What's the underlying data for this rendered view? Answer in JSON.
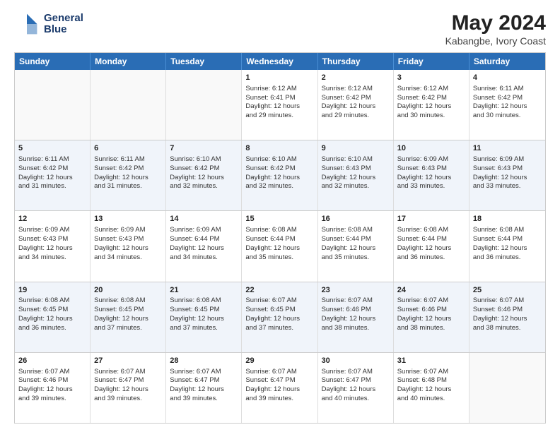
{
  "header": {
    "logo_line1": "General",
    "logo_line2": "Blue",
    "title": "May 2024",
    "subtitle": "Kabangbe, Ivory Coast"
  },
  "days": [
    "Sunday",
    "Monday",
    "Tuesday",
    "Wednesday",
    "Thursday",
    "Friday",
    "Saturday"
  ],
  "weeks": [
    [
      {
        "day": "",
        "text": ""
      },
      {
        "day": "",
        "text": ""
      },
      {
        "day": "",
        "text": ""
      },
      {
        "day": "1",
        "text": "Sunrise: 6:12 AM\nSunset: 6:41 PM\nDaylight: 12 hours\nand 29 minutes."
      },
      {
        "day": "2",
        "text": "Sunrise: 6:12 AM\nSunset: 6:42 PM\nDaylight: 12 hours\nand 29 minutes."
      },
      {
        "day": "3",
        "text": "Sunrise: 6:12 AM\nSunset: 6:42 PM\nDaylight: 12 hours\nand 30 minutes."
      },
      {
        "day": "4",
        "text": "Sunrise: 6:11 AM\nSunset: 6:42 PM\nDaylight: 12 hours\nand 30 minutes."
      }
    ],
    [
      {
        "day": "5",
        "text": "Sunrise: 6:11 AM\nSunset: 6:42 PM\nDaylight: 12 hours\nand 31 minutes."
      },
      {
        "day": "6",
        "text": "Sunrise: 6:11 AM\nSunset: 6:42 PM\nDaylight: 12 hours\nand 31 minutes."
      },
      {
        "day": "7",
        "text": "Sunrise: 6:10 AM\nSunset: 6:42 PM\nDaylight: 12 hours\nand 32 minutes."
      },
      {
        "day": "8",
        "text": "Sunrise: 6:10 AM\nSunset: 6:42 PM\nDaylight: 12 hours\nand 32 minutes."
      },
      {
        "day": "9",
        "text": "Sunrise: 6:10 AM\nSunset: 6:43 PM\nDaylight: 12 hours\nand 32 minutes."
      },
      {
        "day": "10",
        "text": "Sunrise: 6:09 AM\nSunset: 6:43 PM\nDaylight: 12 hours\nand 33 minutes."
      },
      {
        "day": "11",
        "text": "Sunrise: 6:09 AM\nSunset: 6:43 PM\nDaylight: 12 hours\nand 33 minutes."
      }
    ],
    [
      {
        "day": "12",
        "text": "Sunrise: 6:09 AM\nSunset: 6:43 PM\nDaylight: 12 hours\nand 34 minutes."
      },
      {
        "day": "13",
        "text": "Sunrise: 6:09 AM\nSunset: 6:43 PM\nDaylight: 12 hours\nand 34 minutes."
      },
      {
        "day": "14",
        "text": "Sunrise: 6:09 AM\nSunset: 6:44 PM\nDaylight: 12 hours\nand 34 minutes."
      },
      {
        "day": "15",
        "text": "Sunrise: 6:08 AM\nSunset: 6:44 PM\nDaylight: 12 hours\nand 35 minutes."
      },
      {
        "day": "16",
        "text": "Sunrise: 6:08 AM\nSunset: 6:44 PM\nDaylight: 12 hours\nand 35 minutes."
      },
      {
        "day": "17",
        "text": "Sunrise: 6:08 AM\nSunset: 6:44 PM\nDaylight: 12 hours\nand 36 minutes."
      },
      {
        "day": "18",
        "text": "Sunrise: 6:08 AM\nSunset: 6:44 PM\nDaylight: 12 hours\nand 36 minutes."
      }
    ],
    [
      {
        "day": "19",
        "text": "Sunrise: 6:08 AM\nSunset: 6:45 PM\nDaylight: 12 hours\nand 36 minutes."
      },
      {
        "day": "20",
        "text": "Sunrise: 6:08 AM\nSunset: 6:45 PM\nDaylight: 12 hours\nand 37 minutes."
      },
      {
        "day": "21",
        "text": "Sunrise: 6:08 AM\nSunset: 6:45 PM\nDaylight: 12 hours\nand 37 minutes."
      },
      {
        "day": "22",
        "text": "Sunrise: 6:07 AM\nSunset: 6:45 PM\nDaylight: 12 hours\nand 37 minutes."
      },
      {
        "day": "23",
        "text": "Sunrise: 6:07 AM\nSunset: 6:46 PM\nDaylight: 12 hours\nand 38 minutes."
      },
      {
        "day": "24",
        "text": "Sunrise: 6:07 AM\nSunset: 6:46 PM\nDaylight: 12 hours\nand 38 minutes."
      },
      {
        "day": "25",
        "text": "Sunrise: 6:07 AM\nSunset: 6:46 PM\nDaylight: 12 hours\nand 38 minutes."
      }
    ],
    [
      {
        "day": "26",
        "text": "Sunrise: 6:07 AM\nSunset: 6:46 PM\nDaylight: 12 hours\nand 39 minutes."
      },
      {
        "day": "27",
        "text": "Sunrise: 6:07 AM\nSunset: 6:47 PM\nDaylight: 12 hours\nand 39 minutes."
      },
      {
        "day": "28",
        "text": "Sunrise: 6:07 AM\nSunset: 6:47 PM\nDaylight: 12 hours\nand 39 minutes."
      },
      {
        "day": "29",
        "text": "Sunrise: 6:07 AM\nSunset: 6:47 PM\nDaylight: 12 hours\nand 39 minutes."
      },
      {
        "day": "30",
        "text": "Sunrise: 6:07 AM\nSunset: 6:47 PM\nDaylight: 12 hours\nand 40 minutes."
      },
      {
        "day": "31",
        "text": "Sunrise: 6:07 AM\nSunset: 6:48 PM\nDaylight: 12 hours\nand 40 minutes."
      },
      {
        "day": "",
        "text": ""
      }
    ]
  ]
}
